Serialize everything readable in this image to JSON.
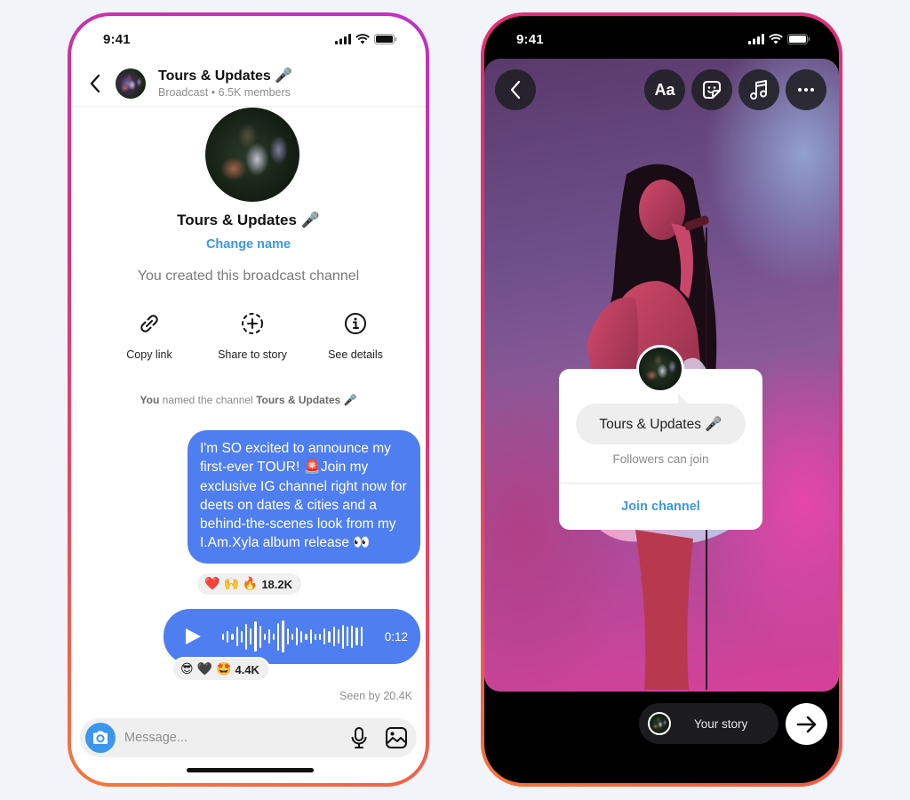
{
  "colors": {
    "accent_blue": "#3b97ec",
    "bubble_blue": "#4f7ef0",
    "page_bg": "#f1f4f8",
    "frame_gradient": [
      "#c030c8",
      "#e0307a",
      "#f5783a"
    ]
  },
  "left_phone": {
    "status_bar": {
      "time": "9:41"
    },
    "header": {
      "back_icon": "chevron-left-icon",
      "title": "Tours & Updates 🎤",
      "subtitle": "Broadcast • 6.5K members"
    },
    "channel": {
      "title": "Tours & Updates 🎤",
      "change_name_label": "Change name",
      "created_text": "You created this broadcast channel"
    },
    "actions": [
      {
        "label": "Copy link",
        "icon": "link-icon"
      },
      {
        "label": "Share to story",
        "icon": "add-story-icon"
      },
      {
        "label": "See details",
        "icon": "info-icon"
      }
    ],
    "named_notice": {
      "prefix": "You",
      "middle": " named the channel ",
      "channel": "Tours & Updates 🎤"
    },
    "messages": [
      {
        "type": "text",
        "text": "I'm SO excited to announce my first-ever TOUR! 🚨Join my exclusive IG channel right now for deets on dates & cities and a behind-the-scenes look from my I.Am.Xyla album release 👀",
        "reactions": {
          "emojis": [
            "❤️",
            "🙌",
            "🔥"
          ],
          "count": "18.2K"
        }
      },
      {
        "type": "voice",
        "duration": "0:12",
        "waveform_levels": [
          0.2,
          0.35,
          0.2,
          0.6,
          0.35,
          0.8,
          0.5,
          0.95,
          0.7,
          0.2,
          0.45,
          0.2,
          0.85,
          1.0,
          0.5,
          0.2,
          0.55,
          0.35,
          0.2,
          0.45,
          0.2,
          0.2,
          0.5,
          0.35,
          0.6,
          0.45,
          0.75,
          0.6,
          0.7,
          0.55,
          0.6
        ],
        "reactions": {
          "emojis": [
            "😎",
            "🖤",
            "🤩"
          ],
          "count": "4.4K"
        }
      }
    ],
    "seen_by": "Seen by 20.4K",
    "composer": {
      "placeholder": "Message...",
      "value": ""
    }
  },
  "right_phone": {
    "status_bar": {
      "time": "9:41"
    },
    "toolbar": {
      "text_tool_label": "Aa"
    },
    "sticker": {
      "channel_name": "Tours & Updates 🎤",
      "followers_text": "Followers can join",
      "join_label": "Join channel"
    },
    "footer": {
      "your_story_label": "Your story"
    }
  }
}
